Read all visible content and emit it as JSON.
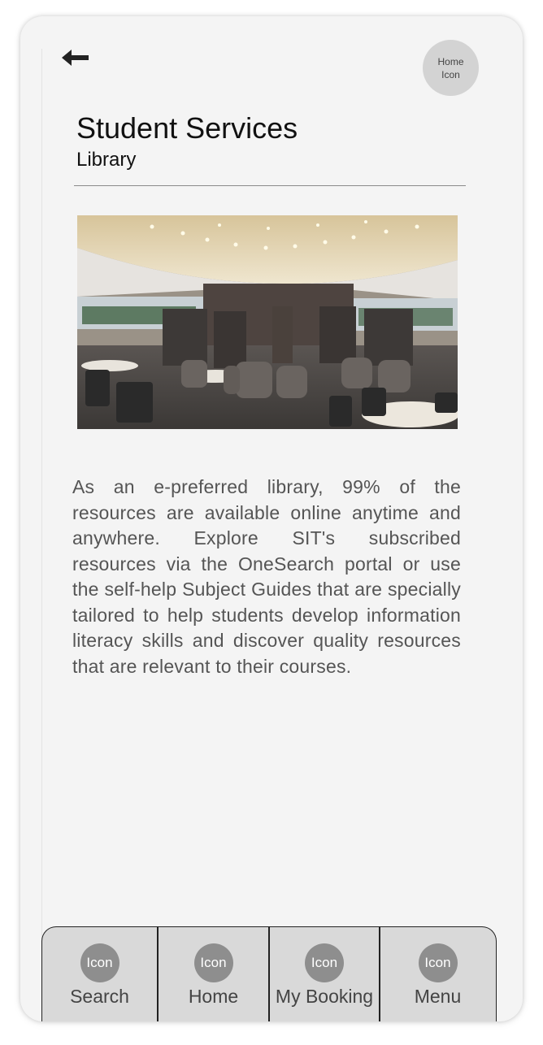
{
  "header": {
    "back_icon": "arrow-left-icon",
    "home_icon_label": "Home\nIcon",
    "title": "Student Services",
    "subtitle": "Library"
  },
  "content": {
    "image": "library-interior-photo",
    "description": "As an e-preferred library, 99% of the resources are available online anytime and anywhere. Explore SIT's subscribed resources via the OneSearch portal or use the self-help Subject Guides that are specially tailored to help students develop information literacy skills and discover quality resources that are relevant to their courses."
  },
  "nav": {
    "items": [
      {
        "icon_label": "Icon",
        "label": "Search"
      },
      {
        "icon_label": "Icon",
        "label": "Home"
      },
      {
        "icon_label": "Icon",
        "label": "My Booking"
      },
      {
        "icon_label": "Icon",
        "label": "Menu"
      }
    ]
  },
  "colors": {
    "background": "#f4f4f4",
    "nav_background": "#d9d9d9",
    "icon_circle": "#8e8e8e",
    "text": "#555555"
  }
}
